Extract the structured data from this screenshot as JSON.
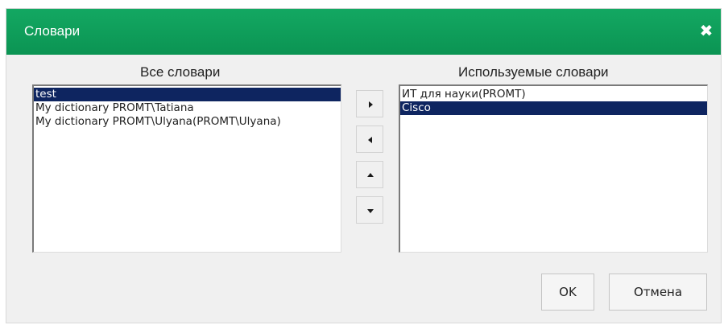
{
  "dialog": {
    "title": "Словари",
    "close_glyph": "✖",
    "accent_color": "#0fa05a",
    "selection_color": "#0e2560"
  },
  "all_dictionaries": {
    "label": "Все словари",
    "items": [
      {
        "text": "test",
        "selected": true
      },
      {
        "text": "My dictionary PROMT\\Tatiana",
        "selected": false
      },
      {
        "text": "My dictionary PROMT\\Ulyana(PROMT\\Ulyana)",
        "selected": false
      }
    ]
  },
  "used_dictionaries": {
    "label": "Используемые словари",
    "items": [
      {
        "text": "ИТ для науки(PROMT)",
        "selected": false
      },
      {
        "text": "Cisco",
        "selected": true
      }
    ]
  },
  "arrows": [
    {
      "icon": "arrow-right-icon",
      "action": "add"
    },
    {
      "icon": "arrow-left-icon",
      "action": "remove"
    },
    {
      "icon": "arrow-up-icon",
      "action": "move-up"
    },
    {
      "icon": "arrow-down-icon",
      "action": "move-down"
    }
  ],
  "buttons": {
    "ok_label": "OK",
    "cancel_label": "Отмена"
  }
}
